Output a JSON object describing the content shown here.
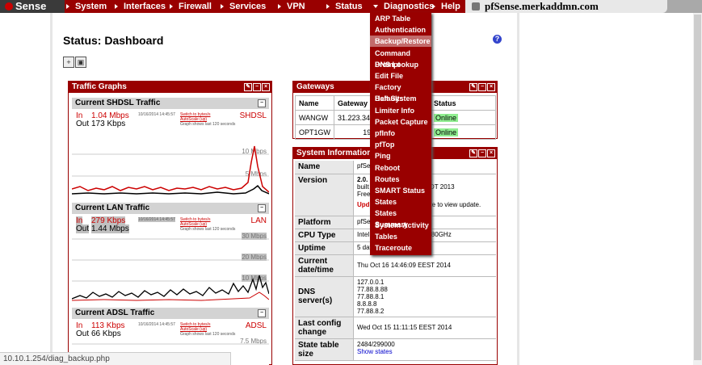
{
  "brand": {
    "logo_text": "Sense"
  },
  "nav": {
    "items": [
      {
        "label": "System"
      },
      {
        "label": "Interfaces"
      },
      {
        "label": "Firewall"
      },
      {
        "label": "Services"
      },
      {
        "label": "VPN"
      },
      {
        "label": "Status"
      },
      {
        "label": "Diagnostics"
      },
      {
        "label": "Help"
      }
    ],
    "hostname": "pfSense.merkaddmn.com"
  },
  "diagnostics_menu": [
    "ARP Table",
    "Authentication",
    "Backup/Restore",
    "Command Prompt",
    "DNS Lookup",
    "Edit File",
    "Factory Defaults",
    "Halt System",
    "Limiter Info",
    "Packet Capture",
    "pfInfo",
    "pfTop",
    "Ping",
    "Reboot",
    "Routes",
    "SMART Status",
    "States",
    "States Summary",
    "System Activity",
    "Tables",
    "Traceroute"
  ],
  "diagnostics_active": "Backup/Restore",
  "page": {
    "title": "Status: Dashboard",
    "help_icon": "?"
  },
  "traffic": {
    "title": "Traffic Graphs",
    "graphs": [
      {
        "heading": "Current SHDSL Traffic",
        "in_label": "In",
        "in_value": "1.04 Mbps",
        "out_label": "Out",
        "out_value": "173 Kbps",
        "timestamp": "10/16/2014 14:45:57",
        "switch_link": "Switch to bytes/s",
        "autoscale_link": "AutoScale (up)",
        "note": "Graph shows last 120 seconds",
        "name": "SHDSL",
        "scales": [
          "10 Mbps",
          "5 Mbps"
        ]
      },
      {
        "heading": "Current LAN Traffic",
        "in_label": "In",
        "in_value": "279 Kbps",
        "out_label": "Out",
        "out_value": "1.44 Mbps",
        "timestamp": "10/16/2014 14:45:57",
        "switch_link": "Switch to bytes/s",
        "autoscale_link": "AutoScale (up)",
        "note": "Graph shows last 120 seconds",
        "name": "LAN",
        "scales": [
          "30 Mbps",
          "20 Mbps",
          "10 Mbps"
        ]
      },
      {
        "heading": "Current ADSL Traffic",
        "in_label": "In",
        "in_value": "113 Kbps",
        "out_label": "Out",
        "out_value": "66 Kbps",
        "timestamp": "10/16/2014 14:45:57",
        "switch_link": "Switch to bytes/s",
        "autoscale_link": "AutoScale (up)",
        "note": "Graph shows last 120 seconds",
        "name": "ADSL",
        "scales": [
          "7.5 Mbps"
        ]
      }
    ]
  },
  "gateways": {
    "title": "Gateways",
    "columns": [
      "Name",
      "Gateway",
      "Status"
    ],
    "rows": [
      {
        "name": "WANGW",
        "gateway": "31.223.34.153",
        "status": "Online"
      },
      {
        "name": "OPT1GW",
        "gateway": "192.168.4.1",
        "status": "Online"
      }
    ]
  },
  "sysinfo": {
    "title": "System Information",
    "name_label": "Name",
    "name_value": "pfSe",
    "version_label": "Version",
    "version_line1": "2.0.",
    "version_line2a": "built",
    "version_line2b": "EDT 2013",
    "version_line3": "Free",
    "version_update": "Upd",
    "version_update_tail": "ere to view update.",
    "platform_label": "Platform",
    "platform_value": "pfSe",
    "cpu_label": "CPU Type",
    "cpu_value_a": "Intel",
    "cpu_value_b": "2.80GHz",
    "uptime_label": "Uptime",
    "uptime_value": "5 day",
    "date_label_1": "Current",
    "date_label_2": "date/time",
    "date_value": "Thu Oct 16 14:46:09 EEST 2014",
    "dns_label_1": "DNS",
    "dns_label_2": "server(s)",
    "dns_values": [
      "127.0.0.1",
      "77.88.8.88",
      "77.88.8.1",
      "8.8.8.8",
      "77.88.8.2"
    ],
    "lastcfg_label_1": "Last config",
    "lastcfg_label_2": "change",
    "lastcfg_value": "Wed Oct 15 11:11:15 EEST 2014",
    "state_label_1": "State table",
    "state_label_2": "size",
    "state_value": "2484/299000",
    "state_link": "Show states"
  },
  "statusbar": {
    "url": "10.10.1.254/diag_backup.php"
  },
  "colors": {
    "accent": "#990000",
    "online": "#90ee90"
  }
}
